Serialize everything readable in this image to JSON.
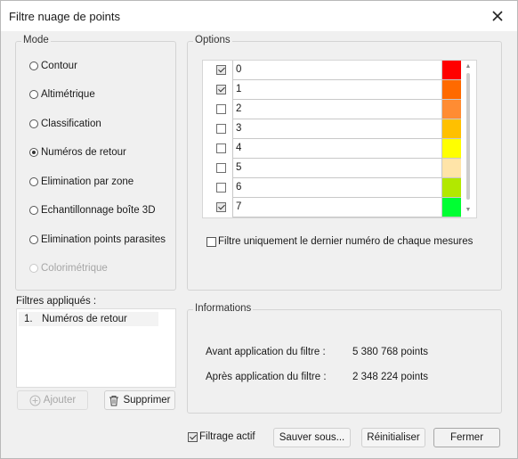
{
  "window": {
    "title": "Filtre nuage de points"
  },
  "mode": {
    "label": "Mode",
    "options": [
      {
        "label": "Contour",
        "checked": false,
        "disabled": false
      },
      {
        "label": "Altimétrique",
        "checked": false,
        "disabled": false
      },
      {
        "label": "Classification",
        "checked": false,
        "disabled": false
      },
      {
        "label": "Numéros de retour",
        "checked": true,
        "disabled": false
      },
      {
        "label": "Elimination par zone",
        "checked": false,
        "disabled": false
      },
      {
        "label": "Echantillonnage boîte 3D",
        "checked": false,
        "disabled": false
      },
      {
        "label": "Elimination points parasites",
        "checked": false,
        "disabled": false
      },
      {
        "label": "Colorimétrique",
        "checked": false,
        "disabled": true
      }
    ]
  },
  "options": {
    "label": "Options",
    "rows": [
      {
        "label": "0",
        "checked": true,
        "color": "#ff0000"
      },
      {
        "label": "1",
        "checked": true,
        "color": "#ff6a00"
      },
      {
        "label": "2",
        "checked": false,
        "color": "#ff8c33"
      },
      {
        "label": "3",
        "checked": false,
        "color": "#ffc000"
      },
      {
        "label": "4",
        "checked": false,
        "color": "#ffff00"
      },
      {
        "label": "5",
        "checked": false,
        "color": "#ffe4a8"
      },
      {
        "label": "6",
        "checked": false,
        "color": "#b2e800"
      },
      {
        "label": "7",
        "checked": true,
        "color": "#00ff33"
      }
    ],
    "last_return_filter": {
      "label": "Filtre uniquement le dernier numéro de chaque mesures",
      "checked": false
    }
  },
  "applied_filters": {
    "label": "Filtres appliqués :",
    "items": [
      {
        "number": "1.",
        "label": "Numéros de retour"
      }
    ],
    "add_label": "Ajouter",
    "delete_label": "Supprimer"
  },
  "information": {
    "label": "Informations",
    "before_label": "Avant application du filtre :",
    "before_value": "5 380 768 points",
    "after_label": "Après application du filtre :",
    "after_value": "2 348 224 points"
  },
  "footer": {
    "active_filter_label": "Filtrage actif",
    "active_filter_checked": true,
    "save_as_label": "Sauver sous...",
    "reset_label": "Réinitialiser",
    "close_label": "Fermer"
  },
  "icons": {
    "close": "close-icon",
    "add": "plus-circle-icon",
    "delete": "trash-icon"
  }
}
